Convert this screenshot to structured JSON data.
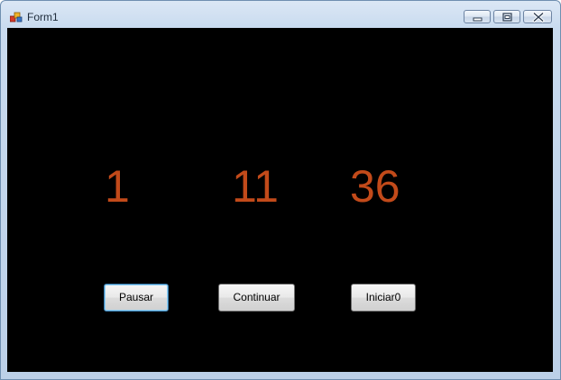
{
  "window": {
    "title": "Form1",
    "controls": {
      "minimize_icon": "minimize-icon",
      "maximize_icon": "maximize-icon",
      "close_icon": "close-icon"
    }
  },
  "counters": {
    "first": "1",
    "second": "11",
    "third": "36"
  },
  "buttons": {
    "pause_label": "Pausar",
    "continue_label": "Continuar",
    "reset_label": "Iniciar0"
  },
  "colors": {
    "client_background": "#000000",
    "counter_text": "#c24a1a"
  }
}
